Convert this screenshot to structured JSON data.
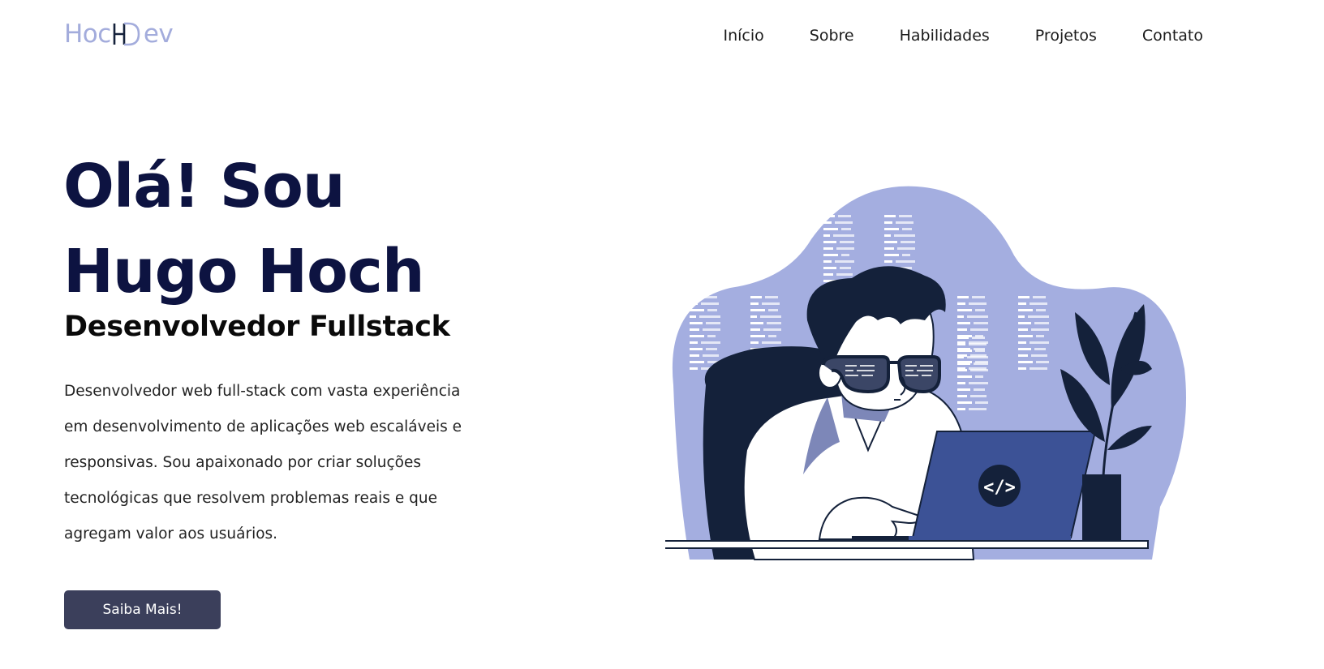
{
  "header": {
    "logo_left": "Hoc",
    "logo_right": "ev",
    "nav": [
      {
        "label": "Início"
      },
      {
        "label": "Sobre"
      },
      {
        "label": "Habilidades"
      },
      {
        "label": "Projetos"
      },
      {
        "label": "Contato"
      }
    ]
  },
  "hero": {
    "title_line1": "Olá! Sou",
    "title_line2": "Hugo Hoch",
    "subtitle": "Desenvolvedor Fullstack",
    "description": "Desenvolvedor web full-stack com vasta experiência em desenvolvimento de aplicações web escaláveis e responsivas. Sou apaixonado por criar soluções tecnológicas que resolvem problemas reais e que agregam valor aos usuários.",
    "cta_label": "Saiba Mais!",
    "code_badge": "</>"
  },
  "colors": {
    "brand_light": "#a3acdc",
    "title_navy": "#0d1341",
    "button_bg": "#3b3f5b",
    "laptop_blue": "#3c5296",
    "dark_navy": "#14213a"
  }
}
